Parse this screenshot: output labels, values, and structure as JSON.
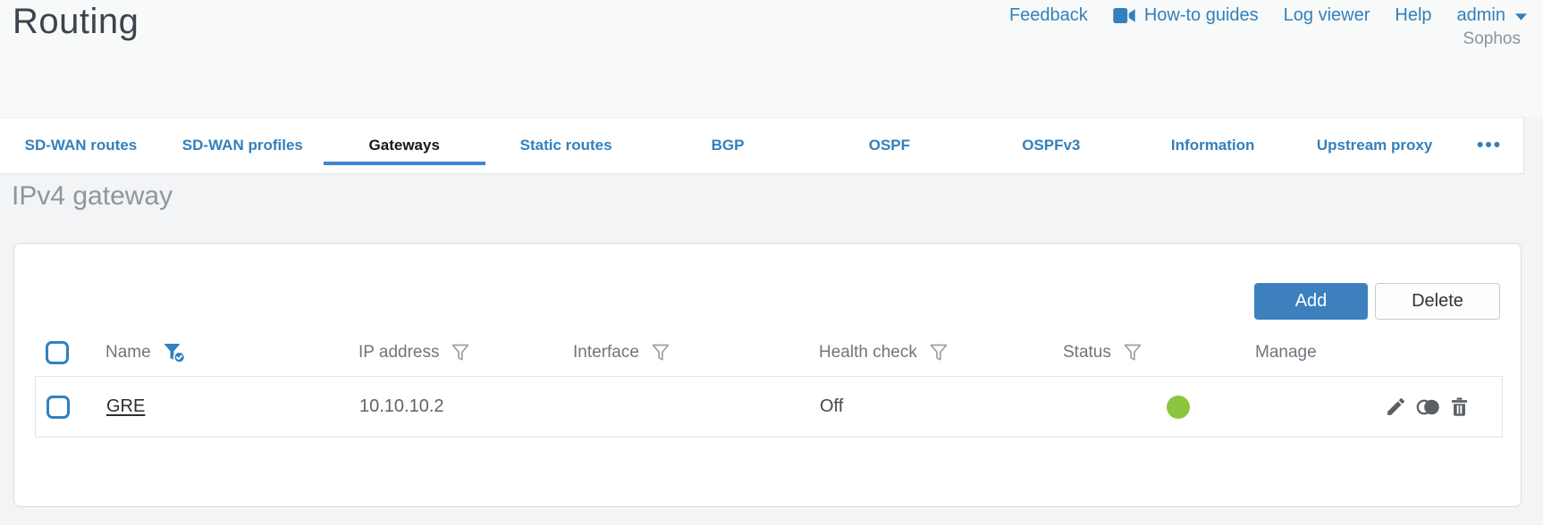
{
  "page": {
    "title": "Routing"
  },
  "topnav": {
    "feedback_label": "Feedback",
    "howto_label": "How-to guides",
    "howto_icon": "video-camera-icon",
    "logviewer_label": "Log viewer",
    "help_label": "Help",
    "user_label": "admin",
    "user_icon": "chevron-down-icon",
    "brand": "Sophos"
  },
  "tabs": {
    "items": [
      {
        "label": "SD-WAN routes",
        "active": false
      },
      {
        "label": "SD-WAN profiles",
        "active": false
      },
      {
        "label": "Gateways",
        "active": true
      },
      {
        "label": "Static routes",
        "active": false
      },
      {
        "label": "BGP",
        "active": false
      },
      {
        "label": "OSPF",
        "active": false
      },
      {
        "label": "OSPFv3",
        "active": false
      },
      {
        "label": "Information",
        "active": false
      },
      {
        "label": "Upstream proxy",
        "active": false
      }
    ],
    "overflow_label": "•••",
    "overflow_icon": "ellipsis-icon"
  },
  "section": {
    "heading": "IPv4 gateway"
  },
  "toolbar": {
    "add_label": "Add",
    "delete_label": "Delete"
  },
  "table": {
    "columns": [
      {
        "label": "Name",
        "filter_icon": "funnel-check-icon",
        "filter_state": "active"
      },
      {
        "label": "IP address",
        "filter_icon": "funnel-icon",
        "filter_state": "inactive"
      },
      {
        "label": "Interface",
        "filter_icon": "funnel-icon",
        "filter_state": "inactive"
      },
      {
        "label": "Health check",
        "filter_icon": "funnel-icon",
        "filter_state": "inactive"
      },
      {
        "label": "Status",
        "filter_icon": "funnel-icon",
        "filter_state": "inactive"
      },
      {
        "label": "Manage",
        "filter_icon": null,
        "filter_state": null
      }
    ],
    "rows": [
      {
        "name": "GRE",
        "ip_address": "10.10.10.2",
        "interface": "",
        "health_check": "Off",
        "status_color": "#8cc63e",
        "manage_icons": [
          "edit-icon",
          "clone-icon",
          "delete-icon"
        ]
      }
    ]
  },
  "colors": {
    "accent_blue": "#3380bc",
    "active_tab_underline": "#3d87cd",
    "status_green": "#8cc63e",
    "primary_button": "#3c80be"
  }
}
